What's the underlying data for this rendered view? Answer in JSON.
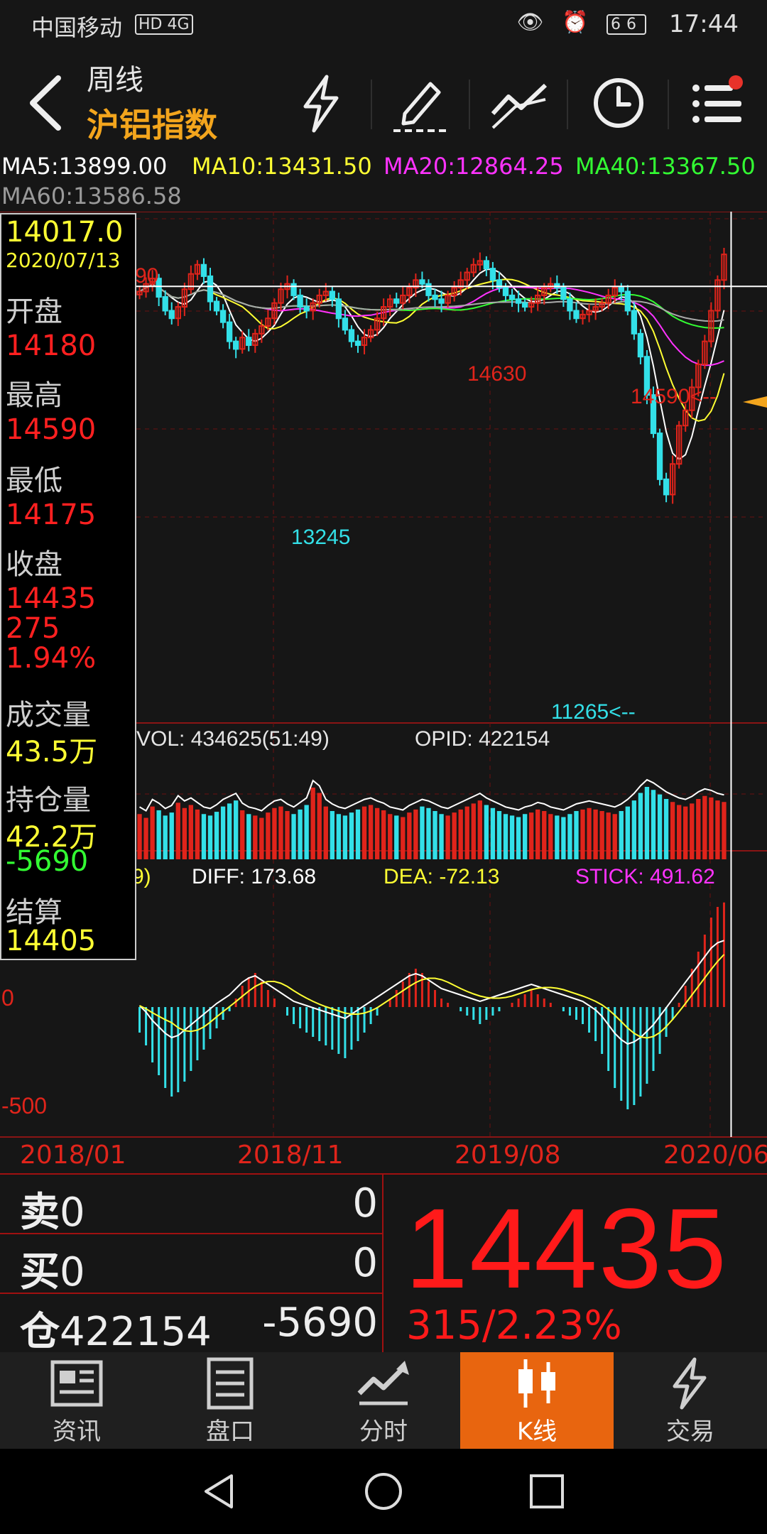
{
  "status": {
    "carrier": "中国移动",
    "network": "HD 4G",
    "battery": "66",
    "time": "17:44"
  },
  "nav": {
    "period": "周线",
    "instrument": "沪铝指数"
  },
  "ma": {
    "ma5": "MA5:13899.00",
    "ma10": "MA10:13431.50",
    "ma20": "MA20:12864.25",
    "ma40": "MA40:13367.50",
    "ma60": "MA60:13586.58"
  },
  "info": {
    "cursor_price": "14017.0",
    "date": "2020/07/13",
    "open_label": "开盘",
    "open": "14180",
    "high_label": "最高",
    "high": "14590",
    "low_label": "最低",
    "low": "14175",
    "close_label": "收盘",
    "close": "14435",
    "close_chg": "275",
    "close_pct": "1.94%",
    "vol_label": "成交量",
    "vol": "43.5万",
    "oi_label": "持仓量",
    "oi": "42.2万",
    "oi_chg": "-5690",
    "settle_label": "结算",
    "settle": "14405"
  },
  "chart_data": {
    "type": "candlestick",
    "frequency": "weekly",
    "price_annotations": {
      "high_1": "14630",
      "low_1": "13245",
      "recent_high": "14590<--",
      "all_low": "11265<--",
      "partial_label": "90"
    },
    "crosshair_price": 14017.0,
    "volume_header": "VOL: 434625(51:49)",
    "opid_header": "OPID: 422154",
    "macd": {
      "partial": "9)",
      "diff": "DIFF: 173.68",
      "dea": "DEA: -72.13",
      "stick": "STICK: 491.62",
      "y_labels": [
        "0",
        "-500"
      ]
    },
    "x_labels": [
      "2018/01",
      "2018/11",
      "2019/08",
      "2020/06"
    ],
    "closes": [
      13950,
      14050,
      14120,
      13880,
      13700,
      13600,
      13750,
      13980,
      14180,
      14300,
      14150,
      13820,
      13700,
      13550,
      13300,
      13200,
      13350,
      13250,
      13400,
      13500,
      13600,
      13800,
      13980,
      14050,
      13900,
      13750,
      13700,
      13800,
      13900,
      13950,
      13850,
      13600,
      13450,
      13300,
      13250,
      13350,
      13450,
      13600,
      13750,
      13850,
      13800,
      13900,
      14000,
      14100,
      14050,
      13900,
      13850,
      13800,
      13900,
      14000,
      14100,
      14200,
      14300,
      14350,
      14250,
      14100,
      14000,
      13900,
      13850,
      13800,
      13750,
      13800,
      13900,
      14000,
      14050,
      14000,
      13850,
      13700,
      13600,
      13650,
      13700,
      13750,
      13800,
      13900,
      14000,
      13950,
      13700,
      13400,
      13100,
      12600,
      12100,
      11500,
      11300,
      11700,
      12200,
      12400,
      12700,
      13000,
      13300,
      13700,
      14100,
      14435
    ],
    "volumes": [
      60,
      55,
      70,
      65,
      58,
      62,
      75,
      68,
      72,
      66,
      60,
      58,
      63,
      70,
      74,
      78,
      65,
      60,
      58,
      55,
      62,
      68,
      70,
      64,
      60,
      66,
      72,
      95,
      88,
      70,
      64,
      60,
      58,
      62,
      66,
      70,
      72,
      68,
      65,
      60,
      58,
      56,
      62,
      66,
      70,
      68,
      64,
      60,
      58,
      62,
      66,
      70,
      74,
      78,
      72,
      68,
      64,
      60,
      58,
      56,
      60,
      62,
      66,
      64,
      60,
      58,
      56,
      60,
      64,
      66,
      68,
      66,
      64,
      62,
      60,
      64,
      70,
      78,
      88,
      96,
      92,
      86,
      80,
      76,
      72,
      70,
      74,
      80,
      84,
      82,
      78,
      76
    ],
    "macd_values": [
      -120,
      -180,
      -260,
      -320,
      -380,
      -420,
      -400,
      -350,
      -300,
      -250,
      -200,
      -150,
      -100,
      -60,
      -20,
      40,
      100,
      140,
      160,
      120,
      80,
      40,
      0,
      -40,
      -80,
      -100,
      -120,
      -140,
      -160,
      -180,
      -200,
      -220,
      -240,
      -200,
      -160,
      -120,
      -80,
      -40,
      0,
      40,
      80,
      120,
      160,
      180,
      160,
      120,
      80,
      40,
      20,
      0,
      -20,
      -40,
      -60,
      -80,
      -60,
      -40,
      -20,
      0,
      20,
      40,
      60,
      80,
      60,
      40,
      20,
      0,
      -20,
      -40,
      -60,
      -80,
      -120,
      -160,
      -220,
      -300,
      -380,
      -440,
      -480,
      -460,
      -420,
      -360,
      -300,
      -220,
      -140,
      -60,
      20,
      100,
      180,
      260,
      340,
      420,
      470,
      491
    ],
    "y_range": [
      11100,
      14900
    ]
  },
  "quote": {
    "sell_label": "卖",
    "sell_price": "0",
    "sell_qty": "0",
    "buy_label": "买",
    "buy_price": "0",
    "buy_qty": "0",
    "oi_label": "仓",
    "oi_value": "422154",
    "oi_change": "-5690",
    "last_price": "14435",
    "change": "315/2.23%"
  },
  "tabs": [
    {
      "label": "资讯"
    },
    {
      "label": "盘口"
    },
    {
      "label": "分时"
    },
    {
      "label": "K线"
    },
    {
      "label": "交易"
    }
  ],
  "colors": {
    "up": "#e0241b",
    "down": "#33e0e8",
    "ma5": "#ffffff",
    "ma10": "#ffff33",
    "ma20": "#ff33ff",
    "ma40": "#33ff33",
    "ma60": "#aaaaaa",
    "accent": "#e8650f",
    "title": "#f3a51d"
  }
}
